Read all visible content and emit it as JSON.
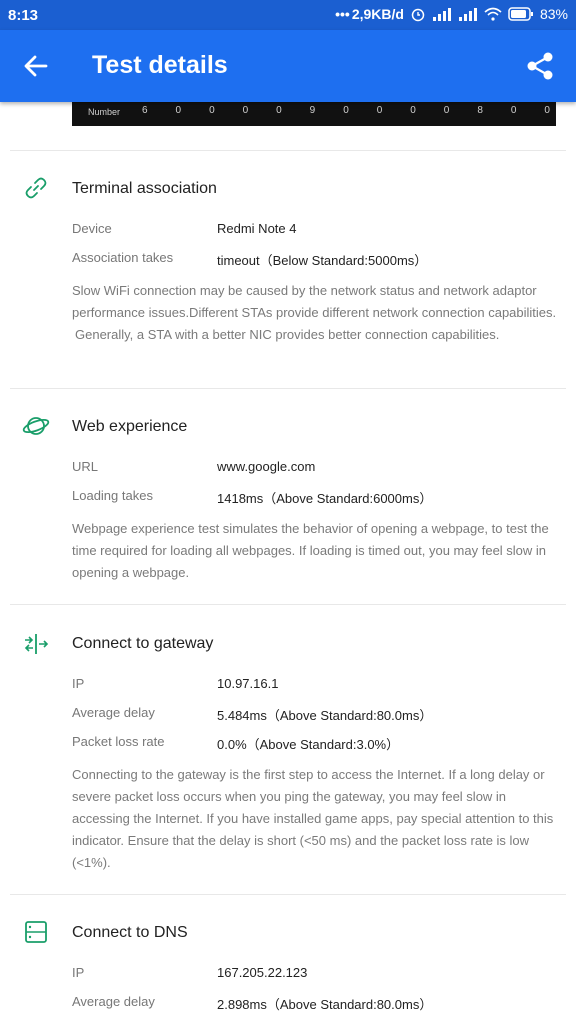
{
  "status_bar": {
    "time": "8:13",
    "speed": "2,9KB/d",
    "battery": "83%"
  },
  "app_bar": {
    "title": "Test details"
  },
  "number_strip": {
    "label": "Number",
    "values": [
      "6",
      "0",
      "0",
      "0",
      "0",
      "9",
      "0",
      "0",
      "0",
      "0",
      "8",
      "0",
      "0"
    ]
  },
  "sections": {
    "terminal": {
      "title": "Terminal association",
      "device_label": "Device",
      "device_value": "Redmi Note 4",
      "assoc_label": "Association takes",
      "assoc_value": "timeout（Below Standard:5000ms）",
      "desc_1": "Slow WiFi connection may be caused by the network status and network adaptor performance issues.Different STAs provide different network connection capabilities.",
      "desc_2": "Generally, a STA with a better NIC provides better connection capabilities."
    },
    "web": {
      "title": "Web experience",
      "url_label": "URL",
      "url_value": "www.google.com",
      "loading_label": "Loading takes",
      "loading_value": "1418ms（Above Standard:6000ms）",
      "desc": "Webpage experience test simulates the behavior of opening a webpage, to test the time required for loading all webpages. If loading is timed out, you may feel slow in opening a webpage."
    },
    "gateway": {
      "title": "Connect to gateway",
      "ip_label": "IP",
      "ip_value": "10.97.16.1",
      "delay_label": "Average delay",
      "delay_value": "5.484ms（Above Standard:80.0ms）",
      "loss_label": "Packet loss rate",
      "loss_value": "0.0%（Above Standard:3.0%）",
      "desc": "Connecting to the gateway is the first step to access the Internet. If a long delay or severe packet loss occurs when you ping the gateway, you may feel slow in accessing the Internet. If you have installed game apps, pay special attention to this indicator. Ensure that the delay is short (<50 ms) and the packet loss rate is low (<1%)."
    },
    "dns": {
      "title": "Connect to DNS",
      "ip_label": "IP",
      "ip_value": "167.205.22.123",
      "delay_label": "Average delay",
      "delay_value": "2.898ms（Above Standard:80.0ms）"
    }
  },
  "colors": {
    "accent": "#1e6ff0",
    "icon_green": "#1a9e6a"
  },
  "icons": [
    "back-arrow-icon",
    "share-icon",
    "link-icon",
    "planet-icon",
    "gateway-icon",
    "server-icon"
  ]
}
